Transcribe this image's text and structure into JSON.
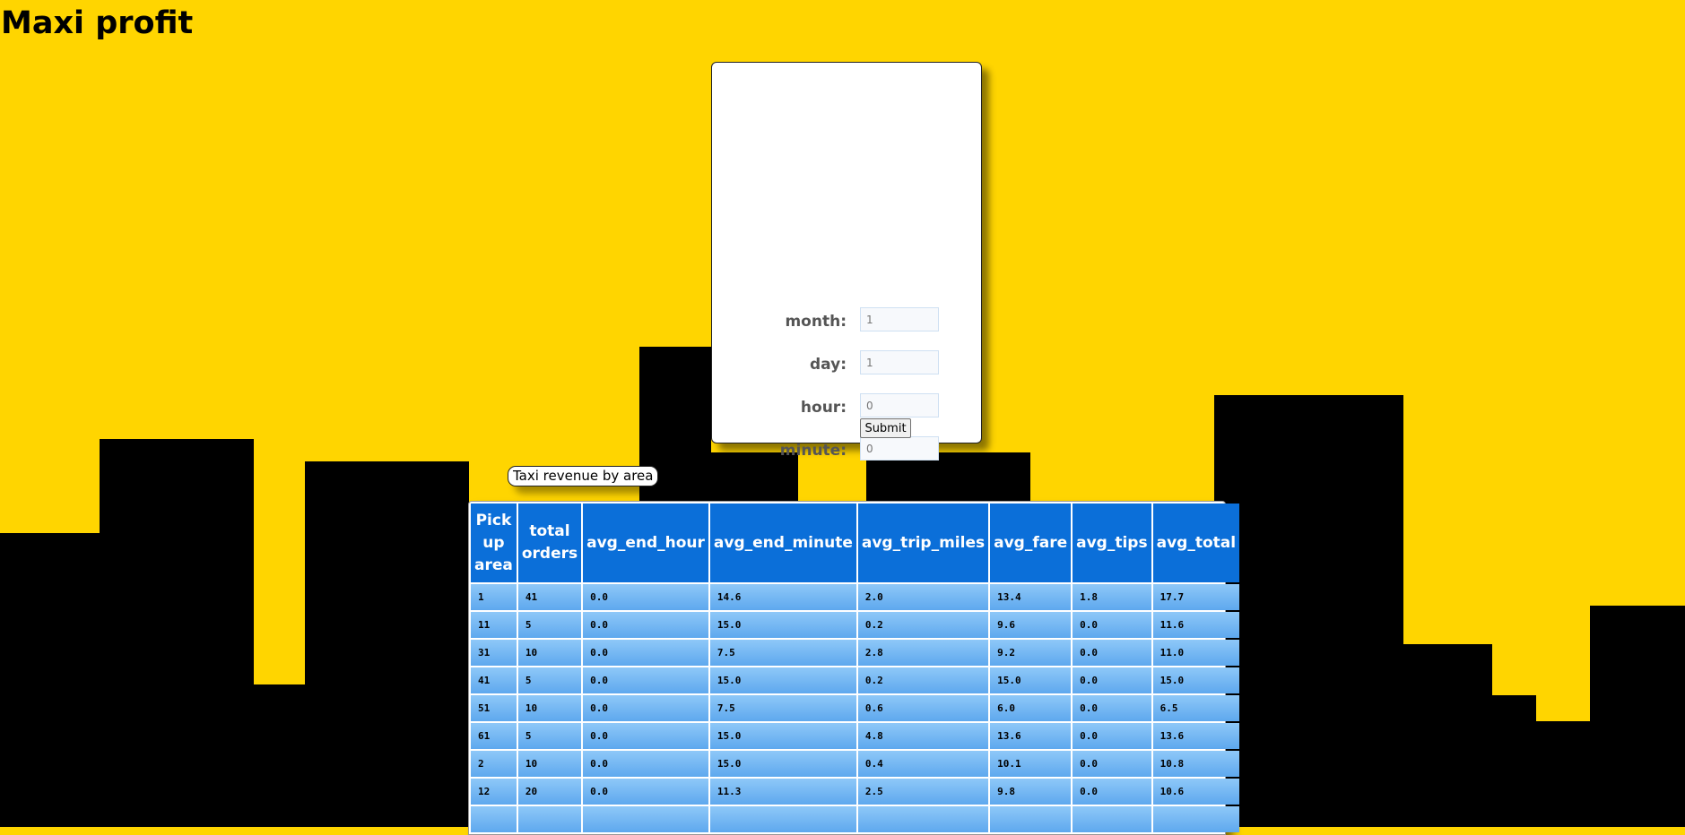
{
  "page": {
    "title": "Maxi profit"
  },
  "form": {
    "fields": [
      {
        "label": "month:",
        "placeholder": "1"
      },
      {
        "label": "day:",
        "placeholder": "1"
      },
      {
        "label": "hour:",
        "placeholder": "0"
      },
      {
        "label": "minute:",
        "placeholder": "0"
      }
    ],
    "submit_label": "Submit"
  },
  "table": {
    "caption": "Taxi revenue by area",
    "headers": [
      "Pick up area",
      "total orders",
      "avg_end_hour",
      "avg_end_minute",
      "avg_trip_miles",
      "avg_fare",
      "avg_tips",
      "avg_total"
    ],
    "rows": [
      [
        "1",
        "41",
        "0.0",
        "14.6",
        "2.0",
        "13.4",
        "1.8",
        "17.7"
      ],
      [
        "11",
        "5",
        "0.0",
        "15.0",
        "0.2",
        "9.6",
        "0.0",
        "11.6"
      ],
      [
        "31",
        "10",
        "0.0",
        "7.5",
        "2.8",
        "9.2",
        "0.0",
        "11.0"
      ],
      [
        "41",
        "5",
        "0.0",
        "15.0",
        "0.2",
        "15.0",
        "0.0",
        "15.0"
      ],
      [
        "51",
        "10",
        "0.0",
        "7.5",
        "0.6",
        "6.0",
        "0.0",
        "6.5"
      ],
      [
        "61",
        "5",
        "0.0",
        "15.0",
        "4.8",
        "13.6",
        "0.0",
        "13.6"
      ],
      [
        "2",
        "10",
        "0.0",
        "15.0",
        "0.4",
        "10.1",
        "0.0",
        "10.8"
      ],
      [
        "12",
        "20",
        "0.0",
        "11.3",
        "2.5",
        "9.8",
        "0.0",
        "10.6"
      ],
      [
        "",
        "",
        "",
        "",
        "",
        "",
        "",
        ""
      ]
    ]
  },
  "colors": {
    "background": "#ffd500",
    "skyline": "#000000",
    "header": "#0b6fd9",
    "cell": "#7ab9f4"
  }
}
